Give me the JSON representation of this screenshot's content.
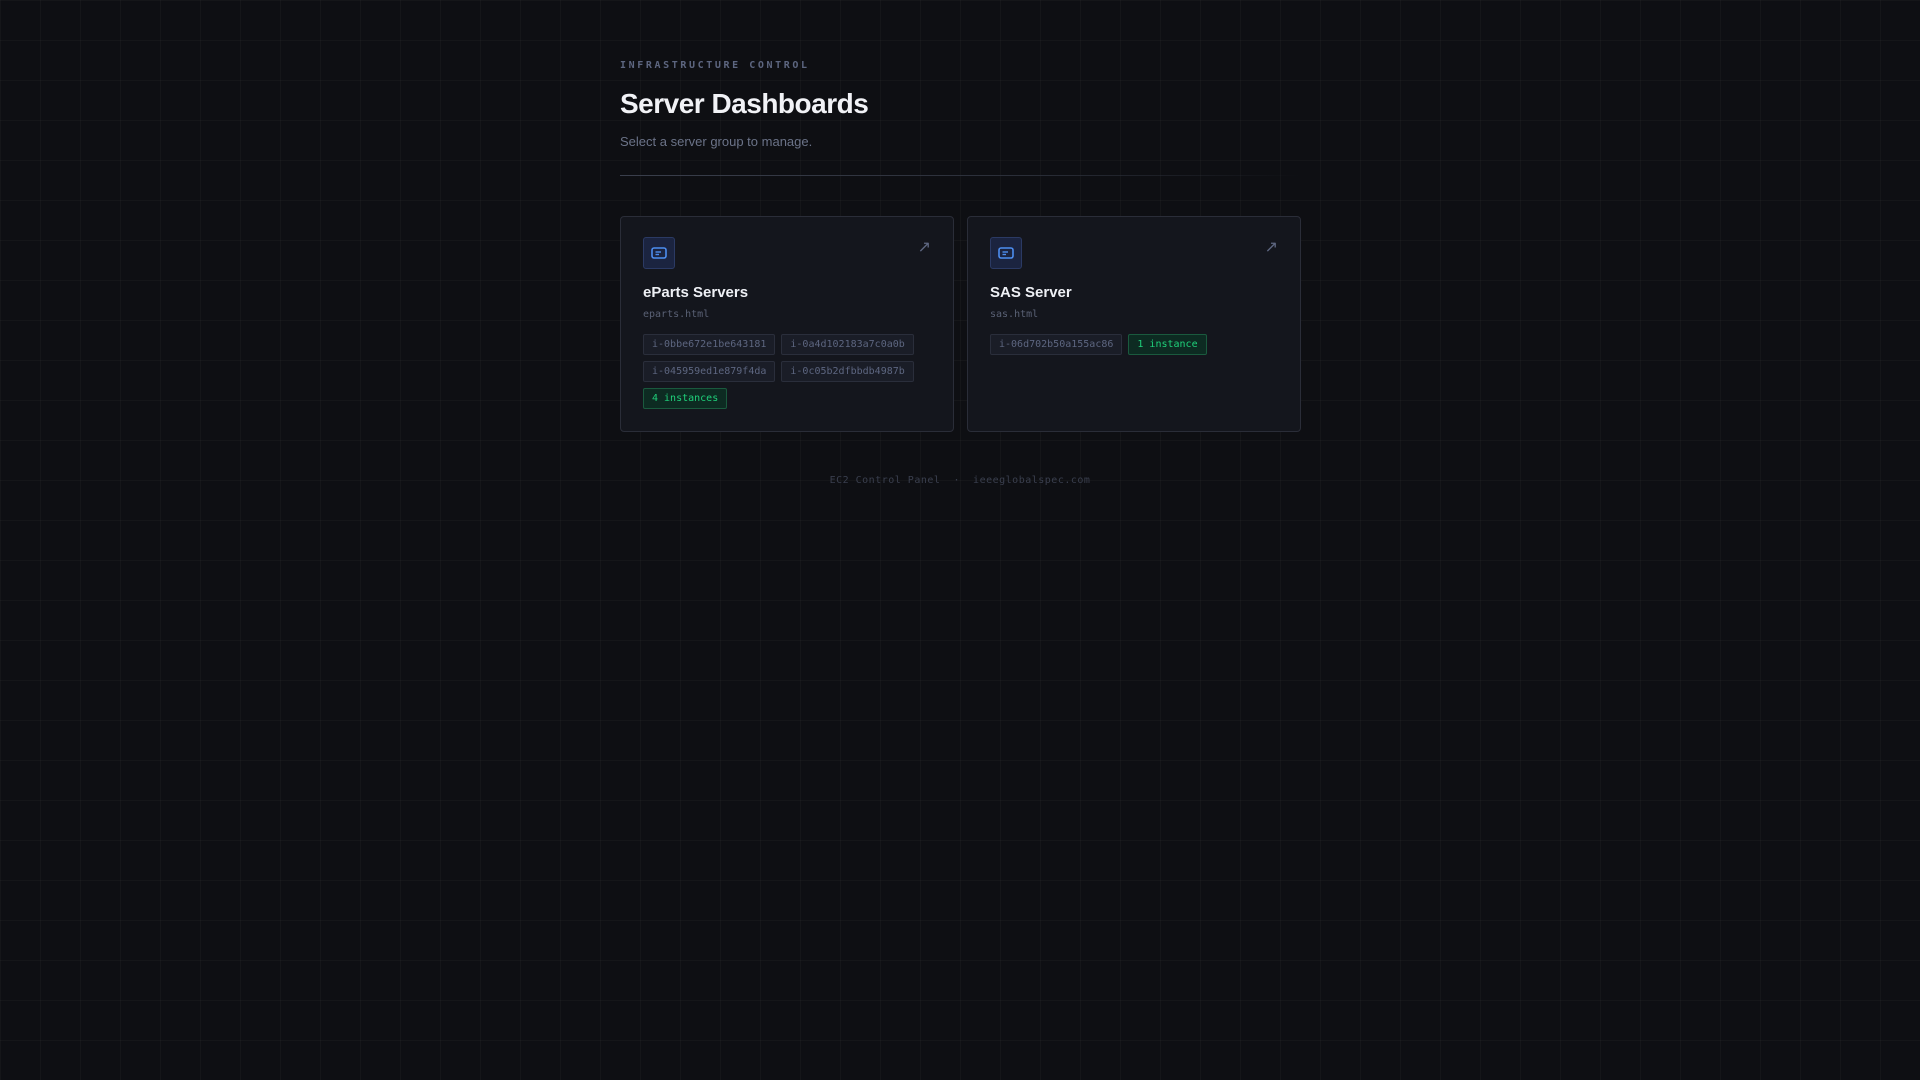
{
  "header": {
    "eyebrow": "INFRASTRUCTURE CONTROL",
    "title": "Server Dashboards",
    "subtitle": "Select a server group to manage."
  },
  "cards": [
    {
      "title": "eParts Servers",
      "file": "eparts.html",
      "instances": [
        "i-0bbe672e1be643181",
        "i-0a4d102183a7c0a0b",
        "i-045959ed1e879f4da",
        "i-0c05b2dfbbdb4987b"
      ],
      "count": "4 instances",
      "icon": "server-icon",
      "link_icon": "arrow-up-right-icon"
    },
    {
      "title": "SAS Server",
      "file": "sas.html",
      "instances": [
        "i-06d702b50a155ac86"
      ],
      "count": "1 instance",
      "icon": "server-icon",
      "link_icon": "arrow-up-right-icon"
    }
  ],
  "footer": {
    "left": "EC2 Control Panel",
    "sep": "·",
    "right": "ieeeglobalspec.com"
  },
  "colors": {
    "accent": "#4d8ef0",
    "success": "#1fd07a"
  }
}
